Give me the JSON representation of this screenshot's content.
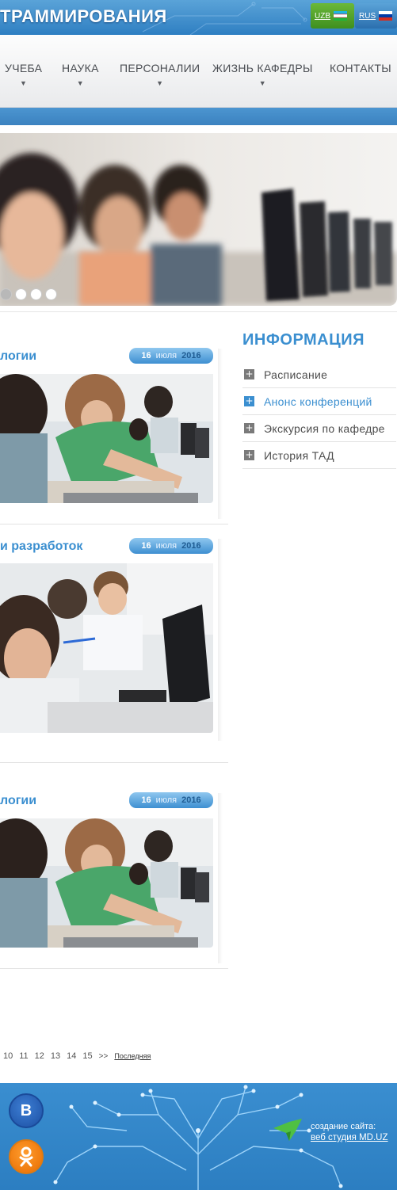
{
  "header": {
    "site_title": "ТРАММИРОВАНИЯ",
    "lang_uz": "UZB",
    "lang_ru": "RUS"
  },
  "nav": {
    "items": [
      {
        "label": "УЧЕБА"
      },
      {
        "label": "НАУКА"
      },
      {
        "label": "ПЕРСОНАЛИИ"
      },
      {
        "label": "ЖИЗНЬ КАФЕДРЫ"
      },
      {
        "label": "КОНТАКТЫ"
      }
    ]
  },
  "slider": {
    "slide_count": 4,
    "active_slide": 1
  },
  "news": [
    {
      "title": "логии",
      "day": "16",
      "month": "июля",
      "year": "2016"
    },
    {
      "title": "и разработок",
      "day": "16",
      "month": "июля",
      "year": "2016"
    },
    {
      "title": "логии",
      "day": "16",
      "month": "июля",
      "year": "2016"
    }
  ],
  "sidebar": {
    "heading": "ИНФОРМАЦИЯ",
    "items": [
      {
        "label": "Расписание",
        "active": false
      },
      {
        "label": "Анонс конференций",
        "active": true
      },
      {
        "label": "Экскурсия по кафедре",
        "active": false
      },
      {
        "label": "История ТАД",
        "active": false
      }
    ]
  },
  "pagination": {
    "pages": [
      "10",
      "11",
      "12",
      "13",
      "14",
      "15"
    ],
    "next": ">>",
    "last": "Последняя"
  },
  "footer": {
    "credit_line1": "создание сайта:",
    "credit_link": "веб студия MD.UZ",
    "vk_letter": "B"
  },
  "colors": {
    "brand_blue": "#3b8fd0",
    "lang_uz_green": "#4f9e28"
  }
}
